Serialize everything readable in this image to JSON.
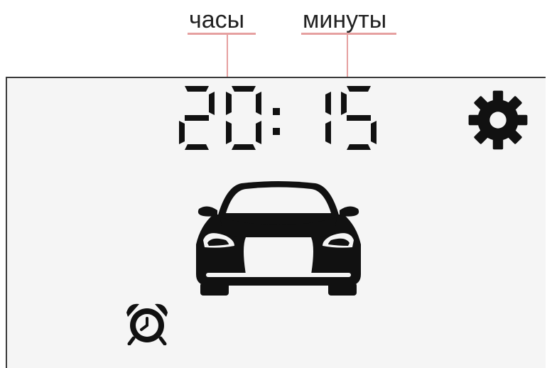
{
  "annotations": {
    "hours_label": "часы",
    "minutes_label": "минуты"
  },
  "clock": {
    "hours": "20",
    "separator": ":",
    "minutes": "15"
  },
  "icons": {
    "settings": "gear-icon",
    "vehicle": "car-icon",
    "alarm": "alarm-clock-icon"
  },
  "colors": {
    "screen_background": "#f5f5f5",
    "foreground": "#111111",
    "annotation_line": "#e6a0a0"
  }
}
